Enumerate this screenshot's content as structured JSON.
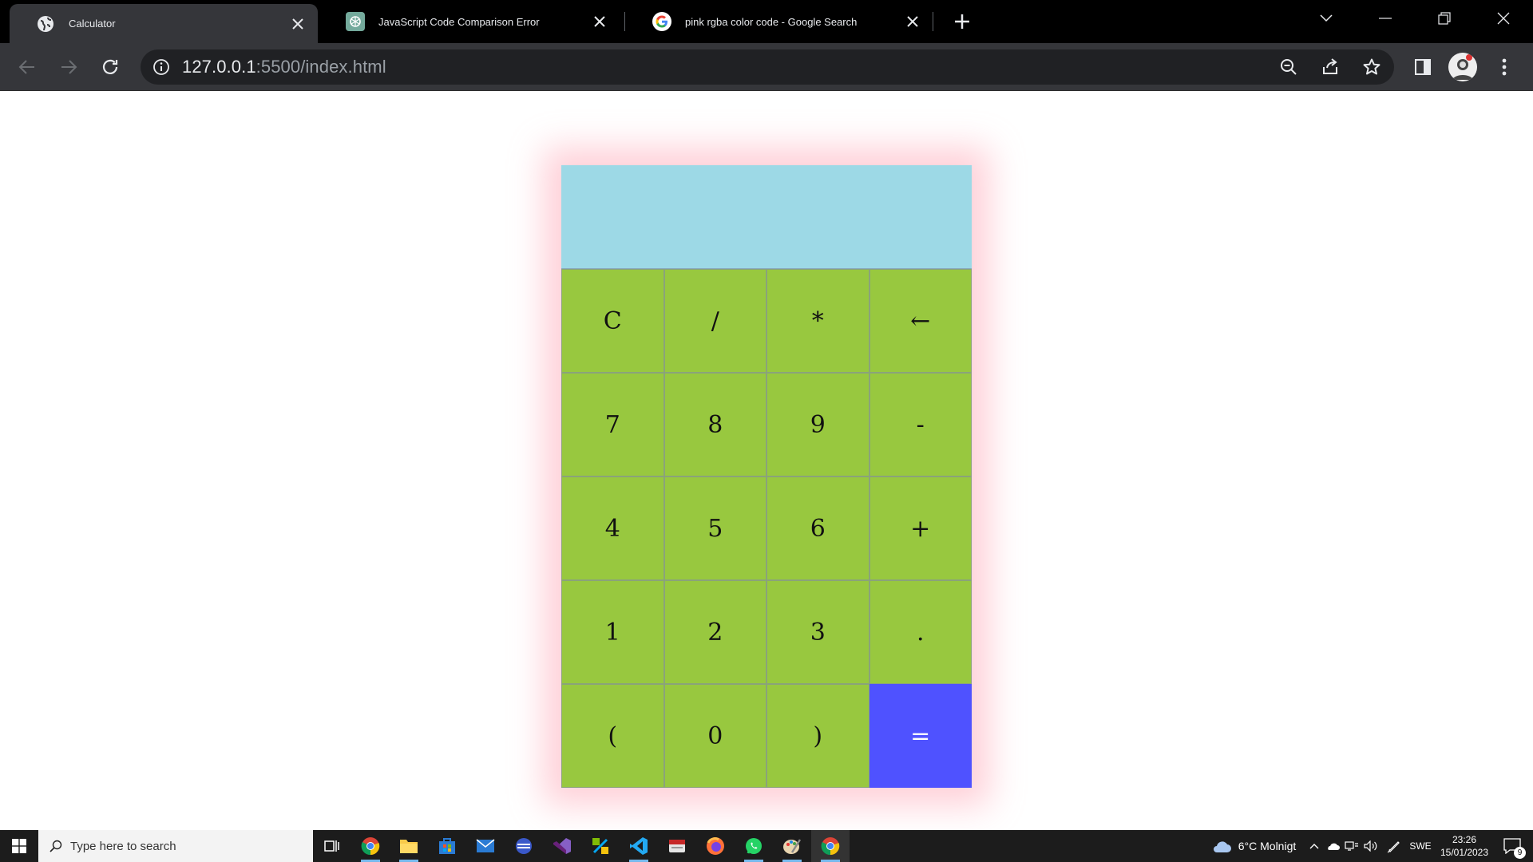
{
  "browser": {
    "tabs": [
      {
        "title": "Calculator",
        "active": true,
        "icon": "globe-icon"
      },
      {
        "title": "JavaScript Code Comparison Error",
        "active": false,
        "icon": "openai-icon"
      },
      {
        "title": "pink rgba color code - Google Search",
        "active": false,
        "icon": "google-icon"
      }
    ],
    "url_host": "127.0.0.1",
    "url_rest": ":5500/index.html"
  },
  "calculator": {
    "display_value": "",
    "keys": [
      "C",
      "/",
      "*",
      "←",
      "7",
      "8",
      "9",
      "-",
      "4",
      "5",
      "6",
      "+",
      "1",
      "2",
      "3",
      ".",
      "(",
      "0",
      ")",
      "="
    ],
    "colors": {
      "display": "#9dd9e6",
      "key": "#98c83f",
      "equals": "#4f52ff",
      "glow": "rgba(255,192,203,0.75)"
    }
  },
  "taskbar": {
    "search_placeholder": "Type here to search",
    "weather": "6°C  Molnigt",
    "language": "SWE",
    "time": "23:26",
    "date": "15/01/2023",
    "notification_count": "9"
  }
}
